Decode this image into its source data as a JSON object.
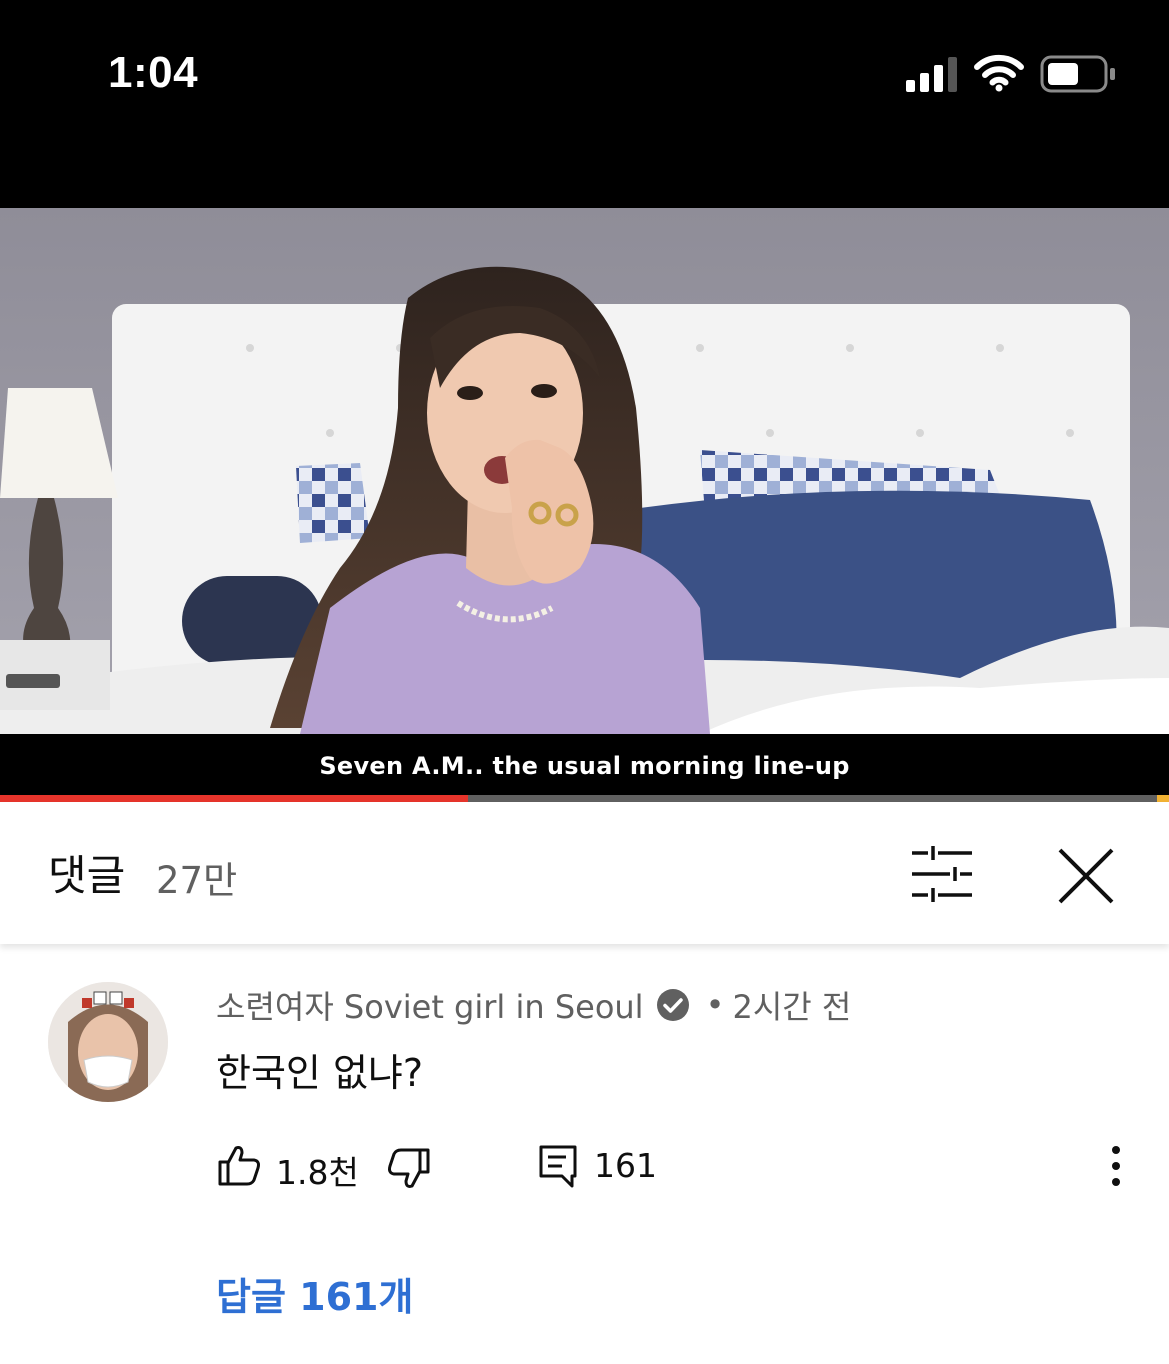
{
  "status_bar": {
    "time": "1:04",
    "icons": [
      "cellular-signal-icon",
      "wifi-icon",
      "battery-icon"
    ]
  },
  "video": {
    "subtitle": "Seven A.M.. the usual morning line-up",
    "progress_fraction": 0.4,
    "progress_color": "#e6342b"
  },
  "comments_header": {
    "title": "댓글",
    "count": "27만",
    "filter_icon": "sliders-icon",
    "close_icon": "close-icon"
  },
  "comment": {
    "author": "소련여자 Soviet girl in Seoul",
    "verified": true,
    "separator": "•",
    "time_ago": "2시간 전",
    "text": "한국인 없냐?",
    "likes": "1.8천",
    "replies": "161",
    "replies_link": "답글 161개",
    "link_color": "#2e6fd3"
  }
}
